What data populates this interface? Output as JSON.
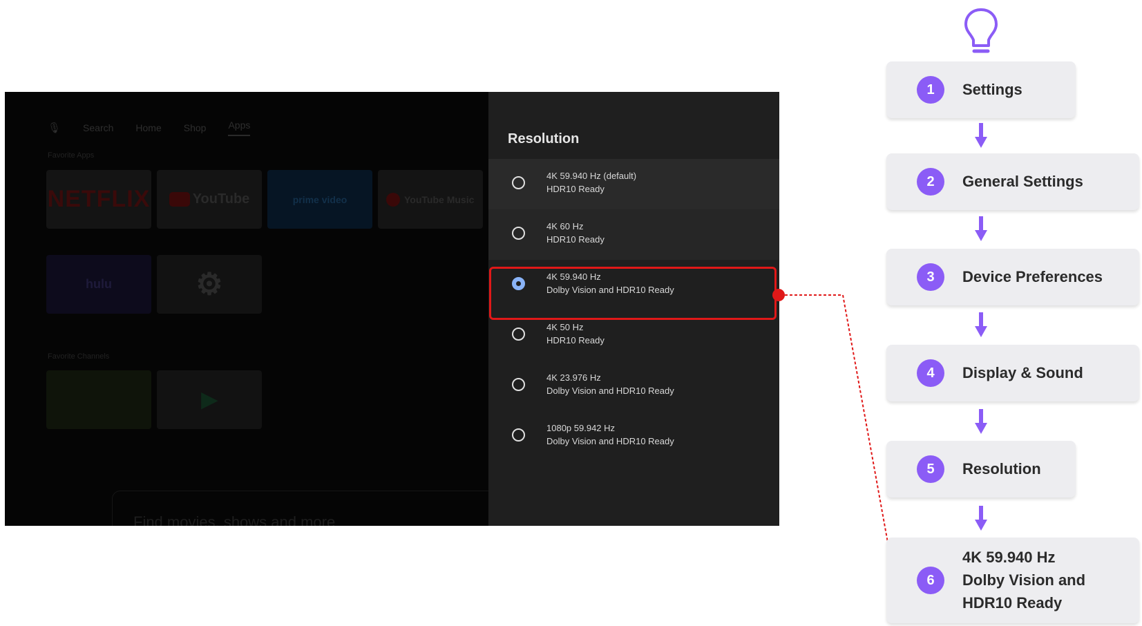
{
  "tv": {
    "nav": [
      "Search",
      "Home",
      "Shop",
      "Apps"
    ],
    "section_apps": "Favorite Apps",
    "section_channels": "Favorite Channels",
    "tiles": {
      "netflix": "NETFLIX",
      "youtube": "YouTube",
      "prime": "prime video",
      "ytmusic": "YouTube Music",
      "hulu": "hulu",
      "settings": "settings",
      "fruit": "",
      "play": ""
    },
    "searchbar": "Find movies, shows and more",
    "panel": {
      "title": "Resolution",
      "options": [
        {
          "line1": "4K 59.940 Hz (default)",
          "line2": "HDR10 Ready",
          "selected": false
        },
        {
          "line1": "4K 60 Hz",
          "line2": "HDR10 Ready",
          "selected": false
        },
        {
          "line1": "4K 59.940 Hz",
          "line2": "Dolby Vision and HDR10 Ready",
          "selected": true
        },
        {
          "line1": "4K 50 Hz",
          "line2": "HDR10 Ready",
          "selected": false
        },
        {
          "line1": "4K 23.976 Hz",
          "line2": "Dolby Vision and HDR10 Ready",
          "selected": false
        },
        {
          "line1": "1080p 59.942 Hz",
          "line2": "Dolby Vision and HDR10 Ready",
          "selected": false
        }
      ]
    }
  },
  "steps": [
    {
      "num": "1",
      "label": "Settings"
    },
    {
      "num": "2",
      "label": "General Settings"
    },
    {
      "num": "3",
      "label": "Device Preferences"
    },
    {
      "num": "4",
      "label": "Display & Sound"
    },
    {
      "num": "5",
      "label": "Resolution"
    },
    {
      "num": "6",
      "label_lines": [
        "4K 59.940 Hz",
        "Dolby Vision and",
        "HDR10 Ready"
      ]
    }
  ],
  "colors": {
    "accent_purple": "#8b5cf6",
    "highlight_red": "#e01818",
    "panel_bg": "#1f1f1f"
  },
  "icons": {
    "bulb": "lightbulb-icon",
    "arrow": "arrow-down-icon",
    "radio": "radio-icon",
    "search": "mic-search-icon"
  }
}
